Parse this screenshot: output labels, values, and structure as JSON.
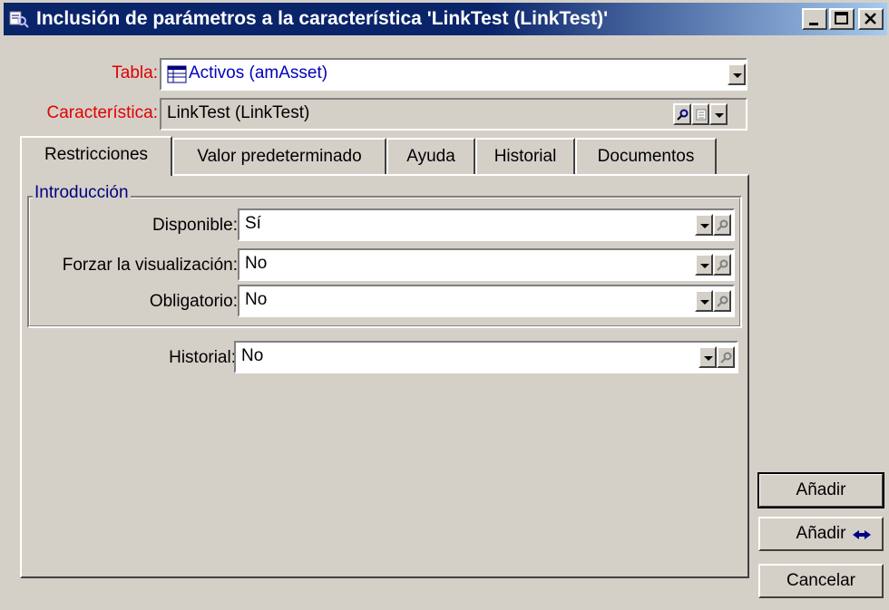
{
  "window": {
    "title": "Inclusión de parámetros a la característica 'LinkTest (LinkTest)'",
    "controls": {
      "minimize": "minimize-icon",
      "maximize": "maximize-icon",
      "close": "close-icon"
    }
  },
  "form": {
    "tabla_label": "Tabla:",
    "tabla_value": "Activos (amAsset)",
    "caracteristica_label": "Característica:",
    "caracteristica_value": "LinkTest (LinkTest)"
  },
  "tabs": [
    {
      "label": "Restricciones",
      "active": true
    },
    {
      "label": "Valor predeterminado",
      "active": false
    },
    {
      "label": "Ayuda",
      "active": false
    },
    {
      "label": "Historial",
      "active": false
    },
    {
      "label": "Documentos",
      "active": false
    }
  ],
  "introduccion": {
    "title": "Introducción",
    "disponible_label": "Disponible:",
    "disponible_value": "Sí",
    "forzar_label": "Forzar la visualización:",
    "forzar_value": "No",
    "obligatorio_label": "Obligatorio:",
    "obligatorio_value": "No"
  },
  "historial": {
    "label": "Historial:",
    "value": "No"
  },
  "buttons": {
    "anadir": "Añadir",
    "anadir_mas": "Añadir",
    "cancelar": "Cancelar"
  },
  "colors": {
    "titlebar": "#0a246a",
    "label_required": "#e00000",
    "link_value": "#0000c0",
    "group_title": "#000080",
    "face": "#d4d0c8"
  }
}
